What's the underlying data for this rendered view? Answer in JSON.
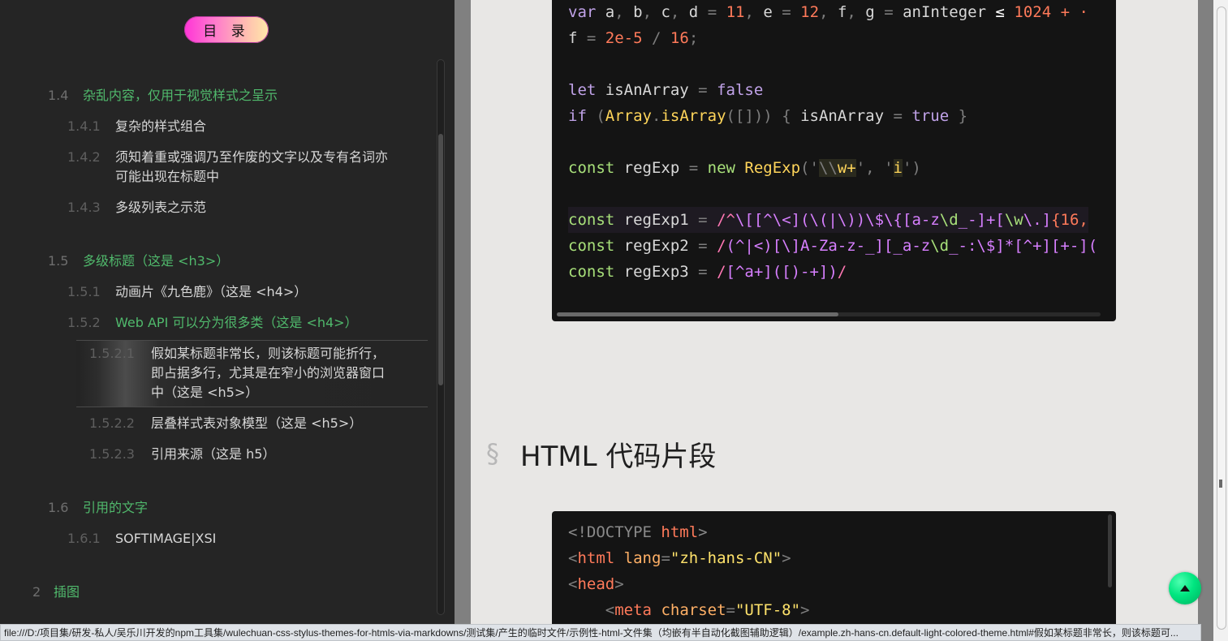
{
  "toc": {
    "title": "目 录",
    "items": [
      {
        "num": "1.4",
        "label": "杂乱内容，仅用于视觉样式之呈示",
        "level": 2
      },
      {
        "num": "1.4.1",
        "label": "复杂的样式组合",
        "level": 3
      },
      {
        "num": "1.4.2",
        "label": "须知着重或强调乃至作废的文字以及专有名词亦",
        "label2": "可能出现在标题中",
        "level": 3
      },
      {
        "num": "1.4.3",
        "label": "多级列表之示范",
        "level": 3
      },
      {
        "num": "1.5",
        "label": "多级标题（这是 <h3>）",
        "level": 2
      },
      {
        "num": "1.5.1",
        "label": "动画片《九色鹿》（这是 <h4>）",
        "level": 3
      },
      {
        "num": "1.5.2",
        "label": "Web API 可以分为很多类（这是 <h4>）",
        "level": 3,
        "active": true
      },
      {
        "num": "1.5.2.1",
        "label": "假如某标题非常长，则该标题可能折行，",
        "label2": "即占据多行，尤其是在窄小的浏览器窗口",
        "label3": "中（这是 <h5>）",
        "level": 4,
        "current": true
      },
      {
        "num": "1.5.2.2",
        "label": "层叠样式表对象模型（这是 <h5>）",
        "level": 4
      },
      {
        "num": "1.5.2.3",
        "label": "引用来源（这是 h5）",
        "level": 4
      },
      {
        "num": "1.6",
        "label": "引用的文字",
        "level": 2
      },
      {
        "num": "1.6.1",
        "label": "SOFTIMAGE|XSI",
        "level": 3
      },
      {
        "num": "2",
        "label": "插图",
        "level": 1
      }
    ]
  },
  "code_js": {
    "lines": [
      "var a, b, c, d = 11, e = 12, f, g = anInteger ≤ 1024 + ·",
      "f = 2e-5 / 16;",
      "",
      "let isAnArray = false",
      "if (Array.isArray([])) { isAnArray = true }",
      "",
      "const regExp = new RegExp('\\\\w+', 'i')",
      "",
      "const regExp1 = /^\\[[^\\<](\\(|\\))\\$\\{[a-z\\d_-]+[\\w\\.]{16,",
      "const regExp2 = /(^|<)[\\]A-Za-z-_][_a-z\\d_-:\\$]*[^+][+-](",
      "const regExp3 = /[^a+]([)-+])/"
    ]
  },
  "section": {
    "mark": "§",
    "title": "HTML 代码片段"
  },
  "code_html": {
    "lines": [
      "<!DOCTYPE html>",
      "<html lang=\"zh-hans-CN\">",
      "<head>",
      "    <meta charset=\"UTF-8\">"
    ]
  },
  "status_bar": {
    "url": "file:///D:/项目集/研发-私人/吴乐川开发的npm工具集/wulechuan-css-stylus-themes-for-htmls-via-markdowns/测试集/产生的临时文件/示例性-html-文件集（均嵌有半自动化截图辅助逻辑）/example.zh-hans-cn.default-light-colored-theme.html#假如某标题非常长，则该标题可..."
  },
  "colors": {
    "toc_bg": "#252525",
    "toc_green": "#50b96c",
    "main_bg": "#e8e7e5",
    "code_bg": "#141414",
    "back_top": "#00e680"
  },
  "icons": {
    "back_to_top": "arrow-up-icon"
  }
}
